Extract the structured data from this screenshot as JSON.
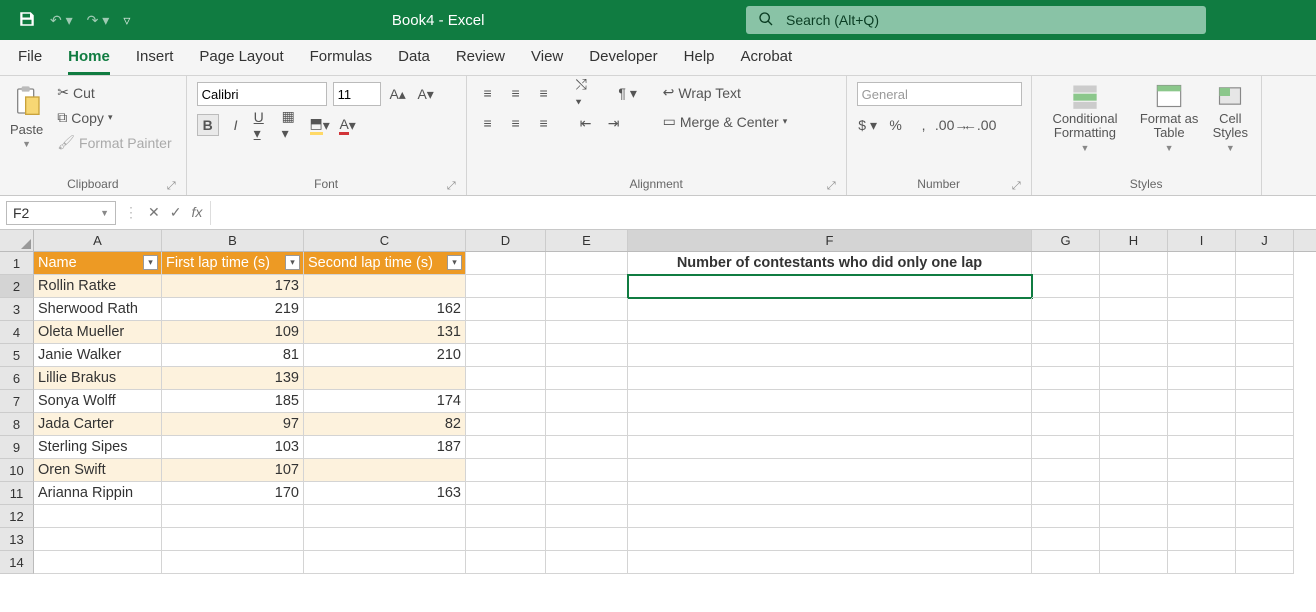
{
  "title": "Book4  -  Excel",
  "search_placeholder": "Search (Alt+Q)",
  "tabs": [
    "File",
    "Home",
    "Insert",
    "Page Layout",
    "Formulas",
    "Data",
    "Review",
    "View",
    "Developer",
    "Help",
    "Acrobat"
  ],
  "active_tab": "Home",
  "clipboard": {
    "paste": "Paste",
    "cut": "Cut",
    "copy": "Copy",
    "fp": "Format Painter",
    "label": "Clipboard"
  },
  "font": {
    "name": "Calibri",
    "size": "11",
    "label": "Font"
  },
  "alignment": {
    "wrap": "Wrap Text",
    "merge": "Merge & Center",
    "label": "Alignment"
  },
  "number": {
    "format": "General",
    "label": "Number"
  },
  "styles": {
    "cf": "Conditional Formatting",
    "fat": "Format as Table",
    "cs": "Cell Styles",
    "label": "Styles"
  },
  "name_box": "F2",
  "formula": "",
  "columns": [
    "A",
    "B",
    "C",
    "D",
    "E",
    "F",
    "G",
    "H",
    "I",
    "J"
  ],
  "headers": {
    "A": "Name",
    "B": "First lap time (s)",
    "C": "Second lap time (s)"
  },
  "f1": "Number of contestants who did only one lap",
  "data": [
    {
      "name": "Rollin Ratke",
      "b": "173",
      "c": ""
    },
    {
      "name": "Sherwood Rath",
      "b": "219",
      "c": "162"
    },
    {
      "name": "Oleta Mueller",
      "b": "109",
      "c": "131"
    },
    {
      "name": "Janie Walker",
      "b": "81",
      "c": "210"
    },
    {
      "name": "Lillie Brakus",
      "b": "139",
      "c": ""
    },
    {
      "name": "Sonya Wolff",
      "b": "185",
      "c": "174"
    },
    {
      "name": "Jada Carter",
      "b": "97",
      "c": "82"
    },
    {
      "name": "Sterling Sipes",
      "b": "103",
      "c": "187"
    },
    {
      "name": "Oren Swift",
      "b": "107",
      "c": ""
    },
    {
      "name": "Arianna Rippin",
      "b": "170",
      "c": "163"
    }
  ]
}
